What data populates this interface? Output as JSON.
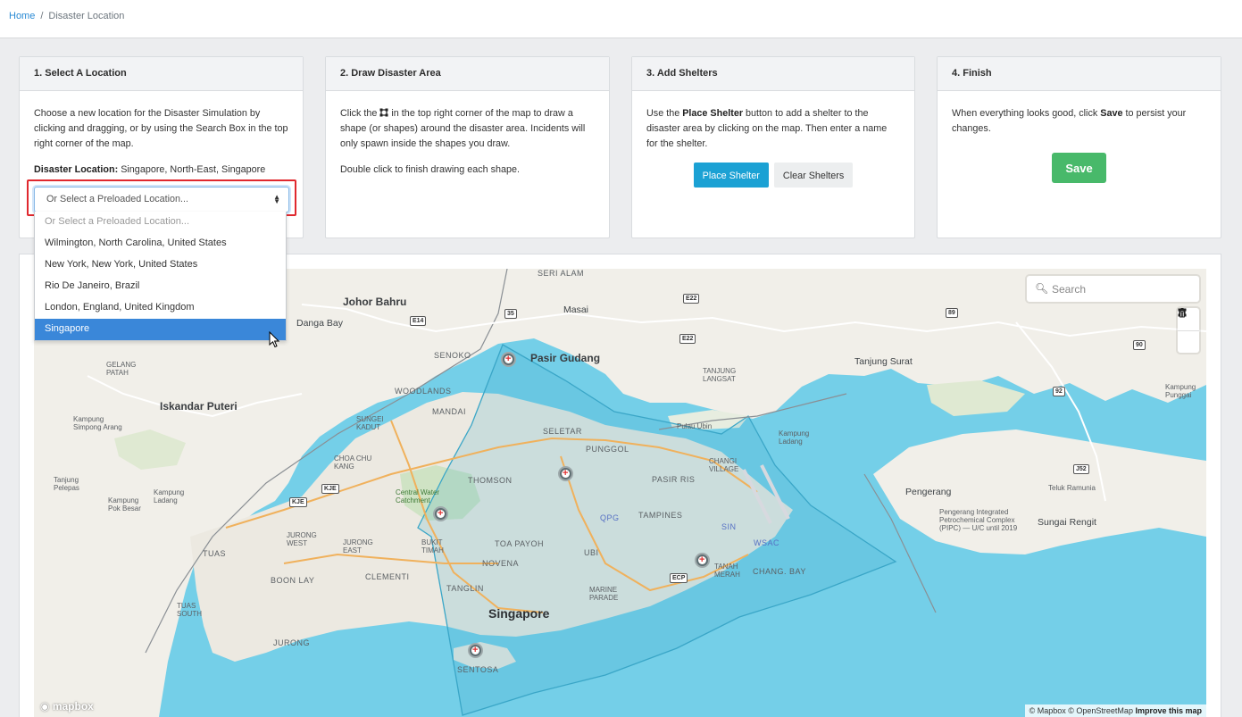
{
  "breadcrumb": {
    "home": "Home",
    "separator": "/",
    "current": "Disaster Location"
  },
  "steps": {
    "select_location": {
      "title": "1. Select A Location",
      "description": "Choose a new location for the Disaster Simulation by clicking and dragging, or by using the Search Box in the top right corner of the map.",
      "location_label": "Disaster Location:",
      "location_value": "Singapore, North-East, Singapore",
      "select_value": "Or Select a Preloaded Location...",
      "options": [
        "Or Select a Preloaded Location...",
        "Wilmington, North Carolina, United States",
        "New York, New York, United States",
        "Rio De Janeiro, Brazil",
        "London, England, United Kingdom",
        "Singapore"
      ],
      "highlighted_option": "Singapore"
    },
    "draw_area": {
      "title": "2. Draw Disaster Area",
      "text_before_icon": "Click the",
      "text_after_icon": "in the top right corner of the map to draw a shape (or shapes) around the disaster area. Incidents will only spawn inside the shapes you draw.",
      "text_2": "Double click to finish drawing each shape."
    },
    "add_shelters": {
      "title": "3. Add Shelters",
      "text_before": "Use the",
      "text_bold": "Place Shelter",
      "text_after": "button to add a shelter to the disaster area by clicking on the map. Then enter a name for the shelter.",
      "place_button": "Place Shelter",
      "clear_button": "Clear Shelters"
    },
    "finish": {
      "title": "4. Finish",
      "text_before": "When everything looks good, click",
      "text_bold": "Save",
      "text_after": "to persist your changes.",
      "save_button": "Save"
    }
  },
  "map": {
    "search_placeholder": "Search",
    "labels": {
      "johor_bahru": "Johor Bahru",
      "iskandar": "Iskandar Puteri",
      "pasir_gudang": "Pasir Gudang",
      "singapore": "Singapore",
      "masai": "Masai",
      "danga_bay": "Danga Bay",
      "seri_alam": "SERI ALAM",
      "tanjung_surat": "Tanjung Surat",
      "pengerang": "Pengerang",
      "sungai_rengit": "Sungai Rengit",
      "teluk_ramunia": "Teluk Ramunia",
      "senoko": "SENOKO",
      "woodlands": "WOODLANDS",
      "mandai": "MANDAI",
      "sungei_kadut": "SUNGEI KADUT",
      "seletar": "SELETAR",
      "punggol": "PUNGGOL",
      "thomson": "THOMSON",
      "pasir_ris": "PASIR RIS",
      "tampines": "TAMPINES",
      "changi_village": "CHANGI VILLAGE",
      "choa_chu_kang": "CHOA CHU KANG",
      "jurong_west": "JURONG WEST",
      "jurong_east": "JURONG EAST",
      "jurong": "JURONG",
      "tuas": "TUAS",
      "tuas_south": "TUAS SOUTH",
      "boon_lay": "BOON LAY",
      "clementi": "CLEMENTI",
      "bukit_timah": "BUKIT TIMAH",
      "toa_payoh": "TOA PAYOH",
      "novena": "NOVENA",
      "tanglin": "TANGLIN",
      "marine_parade": "MARINE PARADE",
      "sentosa": "SENTOSA",
      "tanah_merah": "TANAH MERAH",
      "chang_bay": "CHANG. BAY",
      "ubi": "UBI",
      "gelang_patah": "GELANG PATAH",
      "tanjung_langsat": "TANJUNG LANGSAT",
      "kampung_simpong": "Kampung Simpong Arang",
      "tanjung_pelepas": "Tanjung Pelepas",
      "kampung_pok": "Kampung Pok Besar",
      "kampung_ladang_w": "Kampung Ladang",
      "kampung_ladang_e": "Kampung Ladang",
      "kampung_punggai": "Kampung Punggai",
      "pulau_ubin": "Pulau Ubin",
      "central_water": "Central Water Catchment",
      "pengerang_complex": "Pengerang Integrated Petrochemical Complex (PIPC) — U/C until 2019",
      "sin": "SIN",
      "wsac": "WSAC",
      "qpg": "QPG"
    },
    "shields": [
      "E22",
      "E14",
      "35",
      "E22",
      "89",
      "90",
      "92",
      "J52",
      "KJE",
      "KJE",
      "ECP"
    ],
    "logo": "mapbox",
    "attribution_1": "© Mapbox © OpenStreetMap",
    "attribution_2": "Improve this map",
    "polygon_color": "#3aa6c7",
    "shelter_color": "#e03131"
  }
}
